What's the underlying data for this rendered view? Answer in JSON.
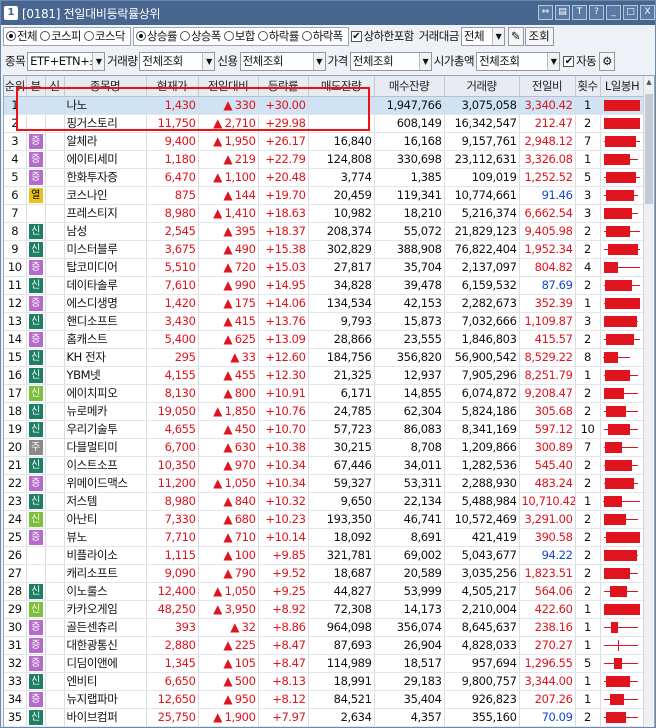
{
  "window": {
    "screen_id": "[0181]",
    "title": "전일대비등락률상위",
    "icon": "1",
    "buttons": [
      {
        "name": "link-icon",
        "glyph": "⇔"
      },
      {
        "name": "document-icon",
        "glyph": "▤"
      },
      {
        "name": "pin-icon",
        "glyph": "T"
      },
      {
        "name": "question-icon",
        "glyph": "?"
      },
      {
        "name": "minimize-icon",
        "glyph": "_"
      },
      {
        "name": "maximize-icon",
        "glyph": "□"
      },
      {
        "name": "close-icon",
        "glyph": "X"
      }
    ]
  },
  "filter1": {
    "market": [
      {
        "label": "전체",
        "checked": true
      },
      {
        "label": "코스피",
        "checked": false
      },
      {
        "label": "코스닥",
        "checked": false
      }
    ],
    "rank_type": [
      {
        "label": "상승률",
        "checked": true
      },
      {
        "label": "상승폭",
        "checked": false
      },
      {
        "label": "보합",
        "checked": false
      },
      {
        "label": "하락률",
        "checked": false
      },
      {
        "label": "하락폭",
        "checked": false
      }
    ],
    "limit_check": {
      "label": "상하한포함",
      "checked": true
    },
    "volume_label": "거래대금",
    "volume_value": "전체",
    "query_label": "조회"
  },
  "filter2": {
    "item_label": "종목",
    "item_value": "ETF+ETN+스팩",
    "volume_label": "거래량",
    "volume_value": "전체조회",
    "credit_label": "신용",
    "credit_value": "전체조회",
    "price_label": "가격",
    "price_value": "전체조회",
    "cap_label": "시가총액",
    "cap_value": "전체조회",
    "auto_label": "자동",
    "auto_checked": true
  },
  "columns": [
    "순위",
    "분",
    "신",
    "종목명",
    "현재가",
    "전일대비",
    "등락률",
    "매도잔량",
    "매수잔량",
    "거래량",
    "전일비",
    "횟수",
    "L일봉H"
  ],
  "colors": {
    "up": "#e0141e",
    "down": "#1446d4",
    "highlight": "#e11"
  },
  "rows": [
    {
      "rank": "1",
      "badge": "",
      "badge_cls": "",
      "credit": "",
      "name": "나노",
      "price": "1,430",
      "change": "330",
      "rate": "+30.00",
      "ask": "",
      "bid": "1,947,766",
      "volume": "3,075,058",
      "ratio": "3,340.42",
      "ratio_dir": "up",
      "count": "1",
      "arrow": "▲",
      "candle": [
        4,
        96,
        4,
        96
      ]
    },
    {
      "rank": "2",
      "badge": "",
      "badge_cls": "",
      "credit": "",
      "name": "핑거스토리",
      "price": "11,750",
      "change": "2,710",
      "rate": "+29.98",
      "ask": "",
      "bid": "608,149",
      "volume": "16,342,547",
      "ratio": "212.47",
      "ratio_dir": "up",
      "count": "2",
      "arrow": "▲",
      "candle": [
        4,
        96,
        4,
        96
      ]
    },
    {
      "rank": "3",
      "badge": "증",
      "badge_cls": "b-jeung",
      "credit": "",
      "name": "알체라",
      "price": "9,400",
      "change": "1,950",
      "rate": "+26.17",
      "ask": "16,840",
      "bid": "16,168",
      "volume": "9,157,761",
      "ratio": "2,948.12",
      "ratio_dir": "up",
      "count": "7",
      "arrow": "▲",
      "candle": [
        4,
        96,
        6,
        86
      ]
    },
    {
      "rank": "4",
      "badge": "증",
      "badge_cls": "b-jeung",
      "credit": "",
      "name": "에이티세미",
      "price": "1,180",
      "change": "219",
      "rate": "+22.79",
      "ask": "124,808",
      "bid": "330,698",
      "volume": "23,112,631",
      "ratio": "3,326.08",
      "ratio_dir": "up",
      "count": "1",
      "arrow": "▲",
      "candle": [
        4,
        90,
        4,
        70
      ]
    },
    {
      "rank": "5",
      "badge": "증",
      "badge_cls": "b-jeung",
      "credit": "",
      "name": "한화투자증",
      "price": "6,470",
      "change": "1,100",
      "rate": "+20.48",
      "ask": "3,774",
      "bid": "1,385",
      "volume": "109,019",
      "ratio": "1,252.52",
      "ratio_dir": "up",
      "count": "5",
      "arrow": "▲",
      "candle": [
        4,
        96,
        8,
        86
      ]
    },
    {
      "rank": "6",
      "badge": "열",
      "badge_cls": "b-yeol",
      "credit": "",
      "name": "코스나인",
      "price": "875",
      "change": "144",
      "rate": "+19.70",
      "ask": "20,459",
      "bid": "119,341",
      "volume": "10,774,661",
      "ratio": "91.46",
      "ratio_dir": "down",
      "count": "3",
      "arrow": "▲",
      "candle": [
        4,
        90,
        10,
        82
      ]
    },
    {
      "rank": "7",
      "badge": "",
      "badge_cls": "",
      "credit": "",
      "name": "프레스티지",
      "price": "8,980",
      "change": "1,410",
      "rate": "+18.63",
      "ask": "10,982",
      "bid": "18,210",
      "volume": "5,216,374",
      "ratio": "6,662.54",
      "ratio_dir": "up",
      "count": "3",
      "arrow": "▲",
      "candle": [
        4,
        90,
        4,
        76
      ]
    },
    {
      "rank": "8",
      "badge": "신",
      "badge_cls": "b-sin",
      "credit": "",
      "name": "남성",
      "price": "2,545",
      "change": "395",
      "rate": "+18.37",
      "ask": "208,374",
      "bid": "55,072",
      "volume": "21,829,123",
      "ratio": "9,405.98",
      "ratio_dir": "up",
      "count": "2",
      "arrow": "▲",
      "candle": [
        4,
        96,
        10,
        70
      ]
    },
    {
      "rank": "9",
      "badge": "신",
      "badge_cls": "b-sin",
      "credit": "",
      "name": "미스터블루",
      "price": "3,675",
      "change": "490",
      "rate": "+15.38",
      "ask": "302,829",
      "bid": "388,908",
      "volume": "76,822,404",
      "ratio": "1,952.34",
      "ratio_dir": "up",
      "count": "2",
      "arrow": "▲",
      "candle": [
        4,
        96,
        14,
        90
      ]
    },
    {
      "rank": "10",
      "badge": "증",
      "badge_cls": "b-jeung",
      "credit": "",
      "name": "탑코미디어",
      "price": "5,510",
      "change": "720",
      "rate": "+15.03",
      "ask": "27,817",
      "bid": "35,704",
      "volume": "2,137,097",
      "ratio": "804.82",
      "ratio_dir": "up",
      "count": "4",
      "arrow": "▲",
      "candle": [
        4,
        96,
        4,
        40
      ]
    },
    {
      "rank": "11",
      "badge": "신",
      "badge_cls": "b-sin",
      "credit": "",
      "name": "데이타솔루",
      "price": "7,610",
      "change": "990",
      "rate": "+14.95",
      "ask": "34,828",
      "bid": "39,478",
      "volume": "6,159,532",
      "ratio": "87.69",
      "ratio_dir": "down",
      "count": "2",
      "arrow": "▲",
      "candle": [
        4,
        96,
        6,
        76
      ]
    },
    {
      "rank": "12",
      "badge": "증",
      "badge_cls": "b-jeung",
      "credit": "",
      "name": "에스디생명",
      "price": "1,420",
      "change": "175",
      "rate": "+14.06",
      "ask": "134,534",
      "bid": "42,153",
      "volume": "2,282,673",
      "ratio": "352.39",
      "ratio_dir": "up",
      "count": "1",
      "arrow": "▲",
      "candle": [
        4,
        96,
        6,
        96
      ]
    },
    {
      "rank": "13",
      "badge": "신",
      "badge_cls": "b-sin",
      "credit": "",
      "name": "핸디소프트",
      "price": "3,430",
      "change": "415",
      "rate": "+13.76",
      "ask": "9,793",
      "bid": "15,873",
      "volume": "7,032,666",
      "ratio": "1,109.87",
      "ratio_dir": "up",
      "count": "3",
      "arrow": "▲",
      "candle": [
        4,
        92,
        4,
        88
      ]
    },
    {
      "rank": "14",
      "badge": "증",
      "badge_cls": "b-jeung",
      "credit": "",
      "name": "홈캐스트",
      "price": "5,400",
      "change": "625",
      "rate": "+13.09",
      "ask": "28,866",
      "bid": "23,555",
      "volume": "1,846,803",
      "ratio": "415.57",
      "ratio_dir": "up",
      "count": "2",
      "arrow": "▲",
      "candle": [
        4,
        96,
        10,
        80
      ]
    },
    {
      "rank": "15",
      "badge": "신",
      "badge_cls": "b-sin",
      "credit": "",
      "name": "KH 전자",
      "price": "295",
      "change": "33",
      "rate": "+12.60",
      "ask": "184,756",
      "bid": "356,820",
      "volume": "56,900,542",
      "ratio": "8,529.22",
      "ratio_dir": "up",
      "count": "8",
      "arrow": "▲",
      "candle": [
        2,
        70,
        4,
        40
      ]
    },
    {
      "rank": "16",
      "badge": "신",
      "badge_cls": "b-sin",
      "credit": "",
      "name": "YBM넷",
      "price": "4,155",
      "change": "455",
      "rate": "+12.30",
      "ask": "21,325",
      "bid": "12,937",
      "volume": "7,905,296",
      "ratio": "8,251.79",
      "ratio_dir": "up",
      "count": "1",
      "arrow": "▲",
      "candle": [
        4,
        92,
        6,
        70
      ]
    },
    {
      "rank": "17",
      "badge": "신",
      "badge_cls": "b-gwal",
      "credit": "",
      "name": "에이치피오",
      "price": "8,130",
      "change": "800",
      "rate": "+10.91",
      "ask": "6,171",
      "bid": "14,855",
      "volume": "6,074,872",
      "ratio": "9,208.47",
      "ratio_dir": "up",
      "count": "2",
      "arrow": "▲",
      "candle": [
        4,
        92,
        4,
        56
      ]
    },
    {
      "rank": "18",
      "badge": "신",
      "badge_cls": "b-sin",
      "credit": "",
      "name": "뉴로메카",
      "price": "19,050",
      "change": "1,850",
      "rate": "+10.76",
      "ask": "24,785",
      "bid": "62,304",
      "volume": "5,824,186",
      "ratio": "305.68",
      "ratio_dir": "up",
      "count": "2",
      "arrow": "▲",
      "candle": [
        4,
        92,
        8,
        60
      ]
    },
    {
      "rank": "19",
      "badge": "신",
      "badge_cls": "b-sin",
      "credit": "",
      "name": "우리기술투",
      "price": "4,655",
      "change": "450",
      "rate": "+10.70",
      "ask": "57,723",
      "bid": "86,083",
      "volume": "8,341,169",
      "ratio": "597.12",
      "ratio_dir": "up",
      "count": "10",
      "arrow": "▲",
      "candle": [
        4,
        92,
        14,
        70
      ]
    },
    {
      "rank": "20",
      "badge": "주",
      "badge_cls": "b-ju",
      "credit": "",
      "name": "다믈멀티미",
      "price": "6,700",
      "change": "630",
      "rate": "+10.38",
      "ask": "30,215",
      "bid": "8,708",
      "volume": "1,209,866",
      "ratio": "300.89",
      "ratio_dir": "up",
      "count": "7",
      "arrow": "▲",
      "candle": [
        4,
        92,
        6,
        50
      ]
    },
    {
      "rank": "21",
      "badge": "신",
      "badge_cls": "b-sin",
      "credit": "",
      "name": "이스트소프",
      "price": "10,350",
      "change": "970",
      "rate": "+10.34",
      "ask": "67,446",
      "bid": "34,011",
      "volume": "1,282,536",
      "ratio": "545.40",
      "ratio_dir": "up",
      "count": "2",
      "arrow": "▲",
      "candle": [
        4,
        90,
        6,
        76
      ]
    },
    {
      "rank": "22",
      "badge": "증",
      "badge_cls": "b-jeung",
      "credit": "",
      "name": "위메이드맥스",
      "price": "11,200",
      "change": "1,050",
      "rate": "+10.34",
      "ask": "59,327",
      "bid": "53,311",
      "volume": "2,288,930",
      "ratio": "483.24",
      "ratio_dir": "up",
      "count": "2",
      "arrow": "▲",
      "candle": [
        4,
        92,
        6,
        80
      ]
    },
    {
      "rank": "23",
      "badge": "신",
      "badge_cls": "b-sin",
      "credit": "",
      "name": "저스템",
      "price": "8,980",
      "change": "840",
      "rate": "+10.32",
      "ask": "9,650",
      "bid": "22,134",
      "volume": "5,488,984",
      "ratio": "10,710.42",
      "ratio_dir": "up",
      "count": "1",
      "arrow": "▲",
      "candle": [
        2,
        96,
        4,
        50
      ]
    },
    {
      "rank": "24",
      "badge": "신",
      "badge_cls": "b-gwal",
      "credit": "",
      "name": "아난티",
      "price": "7,330",
      "change": "680",
      "rate": "+10.23",
      "ask": "193,350",
      "bid": "46,741",
      "volume": "10,572,469",
      "ratio": "3,291.00",
      "ratio_dir": "up",
      "count": "2",
      "arrow": "▲",
      "candle": [
        4,
        92,
        4,
        60
      ]
    },
    {
      "rank": "25",
      "badge": "증",
      "badge_cls": "b-jeung",
      "credit": "",
      "name": "뷰노",
      "price": "7,710",
      "change": "710",
      "rate": "+10.14",
      "ask": "18,092",
      "bid": "8,691",
      "volume": "421,419",
      "ratio": "390.58",
      "ratio_dir": "up",
      "count": "2",
      "arrow": "▲",
      "candle": [
        4,
        92,
        8,
        96
      ]
    },
    {
      "rank": "26",
      "badge": "",
      "badge_cls": "",
      "credit": "",
      "name": "비플라이소",
      "price": "1,115",
      "change": "100",
      "rate": "+9.85",
      "ask": "321,781",
      "bid": "69,002",
      "volume": "5,043,677",
      "ratio": "94.22",
      "ratio_dir": "down",
      "count": "2",
      "arrow": "▲",
      "candle": [
        4,
        92,
        4,
        88
      ]
    },
    {
      "rank": "27",
      "badge": "",
      "badge_cls": "",
      "credit": "",
      "name": "캐리소프트",
      "price": "9,090",
      "change": "790",
      "rate": "+9.52",
      "ask": "18,687",
      "bid": "20,589",
      "volume": "3,035,256",
      "ratio": "1,823.51",
      "ratio_dir": "up",
      "count": "2",
      "arrow": "▲",
      "candle": [
        4,
        92,
        4,
        70
      ]
    },
    {
      "rank": "28",
      "badge": "신",
      "badge_cls": "b-sin",
      "credit": "",
      "name": "이노룰스",
      "price": "12,400",
      "change": "1,050",
      "rate": "+9.25",
      "ask": "44,827",
      "bid": "53,999",
      "volume": "4,505,217",
      "ratio": "564.06",
      "ratio_dir": "up",
      "count": "2",
      "arrow": "▲",
      "candle": [
        4,
        92,
        20,
        64
      ]
    },
    {
      "rank": "29",
      "badge": "신",
      "badge_cls": "b-gwal",
      "credit": "",
      "name": "카카오게임",
      "price": "48,250",
      "change": "3,950",
      "rate": "+8.92",
      "ask": "72,308",
      "bid": "14,173",
      "volume": "2,210,004",
      "ratio": "422.60",
      "ratio_dir": "up",
      "count": "1",
      "arrow": "▲",
      "candle": [
        4,
        96,
        4,
        96
      ]
    },
    {
      "rank": "30",
      "badge": "증",
      "badge_cls": "b-jeung",
      "credit": "",
      "name": "골든센츄리",
      "price": "393",
      "change": "32",
      "rate": "+8.86",
      "ask": "964,098",
      "bid": "356,074",
      "volume": "8,645,637",
      "ratio": "238.16",
      "ratio_dir": "up",
      "count": "1",
      "arrow": "▲",
      "candle": [
        4,
        92,
        22,
        40
      ]
    },
    {
      "rank": "31",
      "badge": "증",
      "badge_cls": "b-jeung",
      "credit": "",
      "name": "대한광통신",
      "price": "2,880",
      "change": "225",
      "rate": "+8.47",
      "ask": "87,693",
      "bid": "26,904",
      "volume": "4,828,033",
      "ratio": "270.27",
      "ratio_dir": "up",
      "count": "1",
      "arrow": "▲",
      "candle": [
        4,
        92,
        40,
        30
      ]
    },
    {
      "rank": "32",
      "badge": "증",
      "badge_cls": "b-jeung",
      "credit": "",
      "name": "디딤이앤에",
      "price": "1,345",
      "change": "105",
      "rate": "+8.47",
      "ask": "114,989",
      "bid": "18,517",
      "volume": "957,694",
      "ratio": "1,296.55",
      "ratio_dir": "up",
      "count": "5",
      "arrow": "▲",
      "candle": [
        4,
        92,
        30,
        50
      ]
    },
    {
      "rank": "33",
      "badge": "신",
      "badge_cls": "b-sin",
      "credit": "",
      "name": "엔비티",
      "price": "6,650",
      "change": "500",
      "rate": "+8.13",
      "ask": "18,991",
      "bid": "29,183",
      "volume": "9,800,757",
      "ratio": "3,344.00",
      "ratio_dir": "up",
      "count": "1",
      "arrow": "▲",
      "candle": [
        4,
        92,
        10,
        70
      ]
    },
    {
      "rank": "34",
      "badge": "증",
      "badge_cls": "b-jeung",
      "credit": "",
      "name": "뉴지랩파마",
      "price": "12,650",
      "change": "950",
      "rate": "+8.12",
      "ask": "84,521",
      "bid": "35,404",
      "volume": "926,823",
      "ratio": "207.26",
      "ratio_dir": "up",
      "count": "1",
      "arrow": "▲",
      "candle": [
        4,
        92,
        20,
        56
      ]
    },
    {
      "rank": "35",
      "badge": "신",
      "badge_cls": "b-sin",
      "credit": "",
      "name": "바이브컴퍼",
      "price": "25,750",
      "change": "1,900",
      "rate": "+7.97",
      "ask": "2,634",
      "bid": "4,357",
      "volume": "355,160",
      "ratio": "70.09",
      "ratio_dir": "down",
      "count": "2",
      "arrow": "▲",
      "candle": [
        4,
        92,
        10,
        60
      ]
    }
  ]
}
